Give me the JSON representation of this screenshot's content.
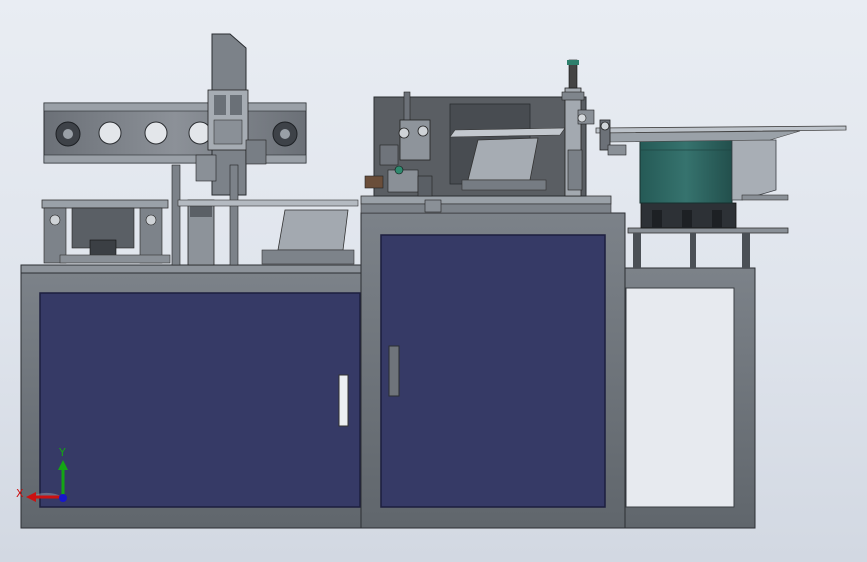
{
  "viewport": {
    "background_top": "#e9edf3",
    "background_bottom": "#d2d8e2"
  },
  "colors": {
    "cabinet_frame": "#6e747b",
    "cabinet_frame_dark": "#52575d",
    "cabinet_door": "#363a66",
    "cabinet_door_edge": "#1f2247",
    "open_bay": "#e7eaef",
    "mechanism": "#8a9097",
    "mechanism_dark": "#4b5056",
    "hopper_green": "#2f6a66",
    "rail": "#b9c0c8",
    "handle": "#e9ecef"
  },
  "triad": {
    "x_label": "X",
    "y_label": "Y",
    "x_color": "#cc1111",
    "y_color": "#14a514",
    "z_color": "#1717cc"
  },
  "model": {
    "left_door_handle": "handle",
    "center_door_handle": "handle"
  }
}
